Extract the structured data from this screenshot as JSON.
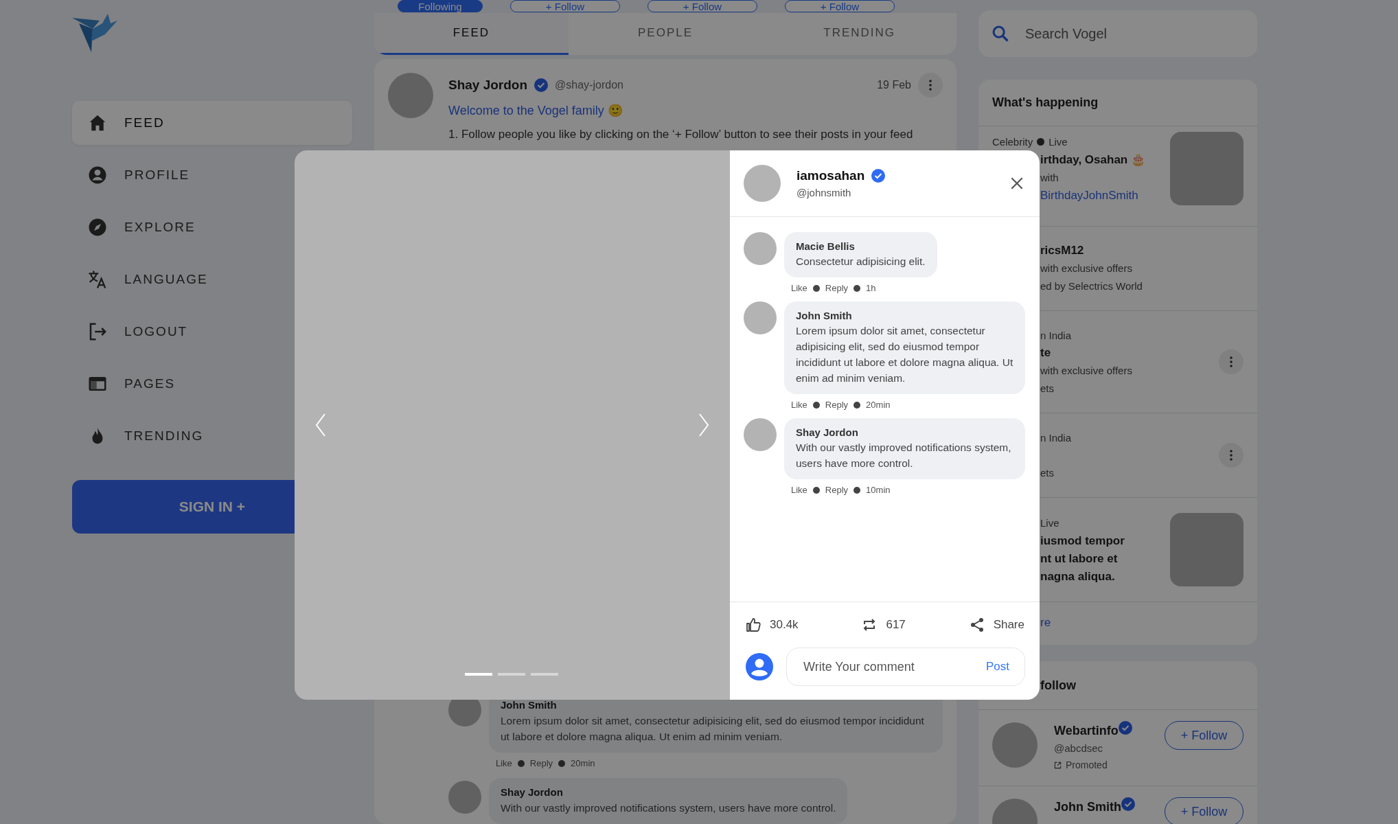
{
  "sidebar": {
    "nav": [
      {
        "label": "FEED",
        "selected": true
      },
      {
        "label": "PROFILE",
        "selected": false
      },
      {
        "label": "EXPLORE",
        "selected": false
      },
      {
        "label": "LANGUAGE",
        "selected": false
      },
      {
        "label": "LOGOUT",
        "selected": false
      },
      {
        "label": "PAGES",
        "selected": false
      },
      {
        "label": "TRENDING",
        "selected": false
      }
    ],
    "sign_in": "SIGN IN +"
  },
  "suggestions": [
    {
      "label": "Following",
      "following": true
    },
    {
      "label": "+ Follow",
      "following": false
    },
    {
      "label": "+ Follow",
      "following": false
    },
    {
      "label": "+ Follow",
      "following": false
    }
  ],
  "tabs": [
    {
      "label": "FEED",
      "selected": true
    },
    {
      "label": "PEOPLE",
      "selected": false
    },
    {
      "label": "TRENDING",
      "selected": false
    }
  ],
  "post": {
    "author": "Shay Jordon",
    "verified": true,
    "handle": "@shay-jordon",
    "date": "19 Feb",
    "greeting": "Welcome to the Vogel family 🙂",
    "text": "1. Follow people you like by clicking on the ‘+ Follow’ button to see their posts in your feed",
    "comments": [
      {
        "name": "John Smith",
        "text": "Lorem ipsum dolor sit amet, consectetur adipisicing elit, sed do eiusmod tempor incididunt ut labore et dolore magna aliqua. Ut enim ad minim veniam.",
        "actions": [
          "Like",
          "Reply"
        ],
        "time": "20min"
      },
      {
        "name": "Shay Jordon",
        "text": "With our vastly improved notifications system, users have more control."
      }
    ]
  },
  "search": {
    "placeholder": "Search Vogel"
  },
  "trends": {
    "title": "What's happening",
    "items": [
      {
        "kind": "image",
        "meta": [
          "Celebrity",
          "Live"
        ],
        "title": [
          "irthday, Osahan 🎂"
        ],
        "lines": [
          "with"
        ],
        "link": "BirthdayJohnSmith"
      },
      {
        "kind": "plain",
        "title": [
          "ricsM12"
        ],
        "lines": [
          "with exclusive offers",
          "ed by Selectrics World"
        ]
      },
      {
        "kind": "menu",
        "meta": [
          "n India"
        ],
        "title": [
          "te"
        ],
        "lines": [
          "with exclusive offers",
          "ets"
        ]
      },
      {
        "kind": "menu",
        "meta": [
          "n India"
        ],
        "lines": [
          "ets"
        ]
      },
      {
        "kind": "image",
        "meta": [
          "Live"
        ],
        "title": [
          "iusmod tempor",
          "nt ut labore et",
          "nagna aliqua."
        ]
      }
    ],
    "more": "re"
  },
  "who_to_follow": {
    "title": "follow",
    "people": [
      {
        "name": "Webartinfo",
        "verified": true,
        "handle": "@abcdsec",
        "promoted": "Promoted",
        "button": "+ Follow"
      },
      {
        "name": "John Smith",
        "verified": true,
        "button": "+ Follow"
      }
    ]
  },
  "modal": {
    "author": "iamosahan",
    "verified": true,
    "handle": "@johnsmith",
    "slides": [
      {
        "selected": true
      },
      {
        "selected": false
      },
      {
        "selected": false
      }
    ],
    "comments": [
      {
        "name": "Macie Bellis",
        "text": "Consectetur adipisicing elit.",
        "actions": [
          "Like",
          "Reply"
        ],
        "time": "1h"
      },
      {
        "name": "John Smith",
        "text": "Lorem ipsum dolor sit amet, consectetur adipisicing elit, sed do eiusmod tempor incididunt ut labore et dolore magna aliqua. Ut enim ad minim veniam.",
        "actions": [
          "Like",
          "Reply"
        ],
        "time": "20min"
      },
      {
        "name": "Shay Jordon",
        "text": "With our vastly improved notifications system, users have more control.",
        "actions": [
          "Like",
          "Reply"
        ],
        "time": "10min"
      }
    ],
    "likes": "30.4k",
    "reposts": "617",
    "share": "Share",
    "comment_field": {
      "placeholder": "Write Your comment",
      "submit": "Post"
    }
  }
}
